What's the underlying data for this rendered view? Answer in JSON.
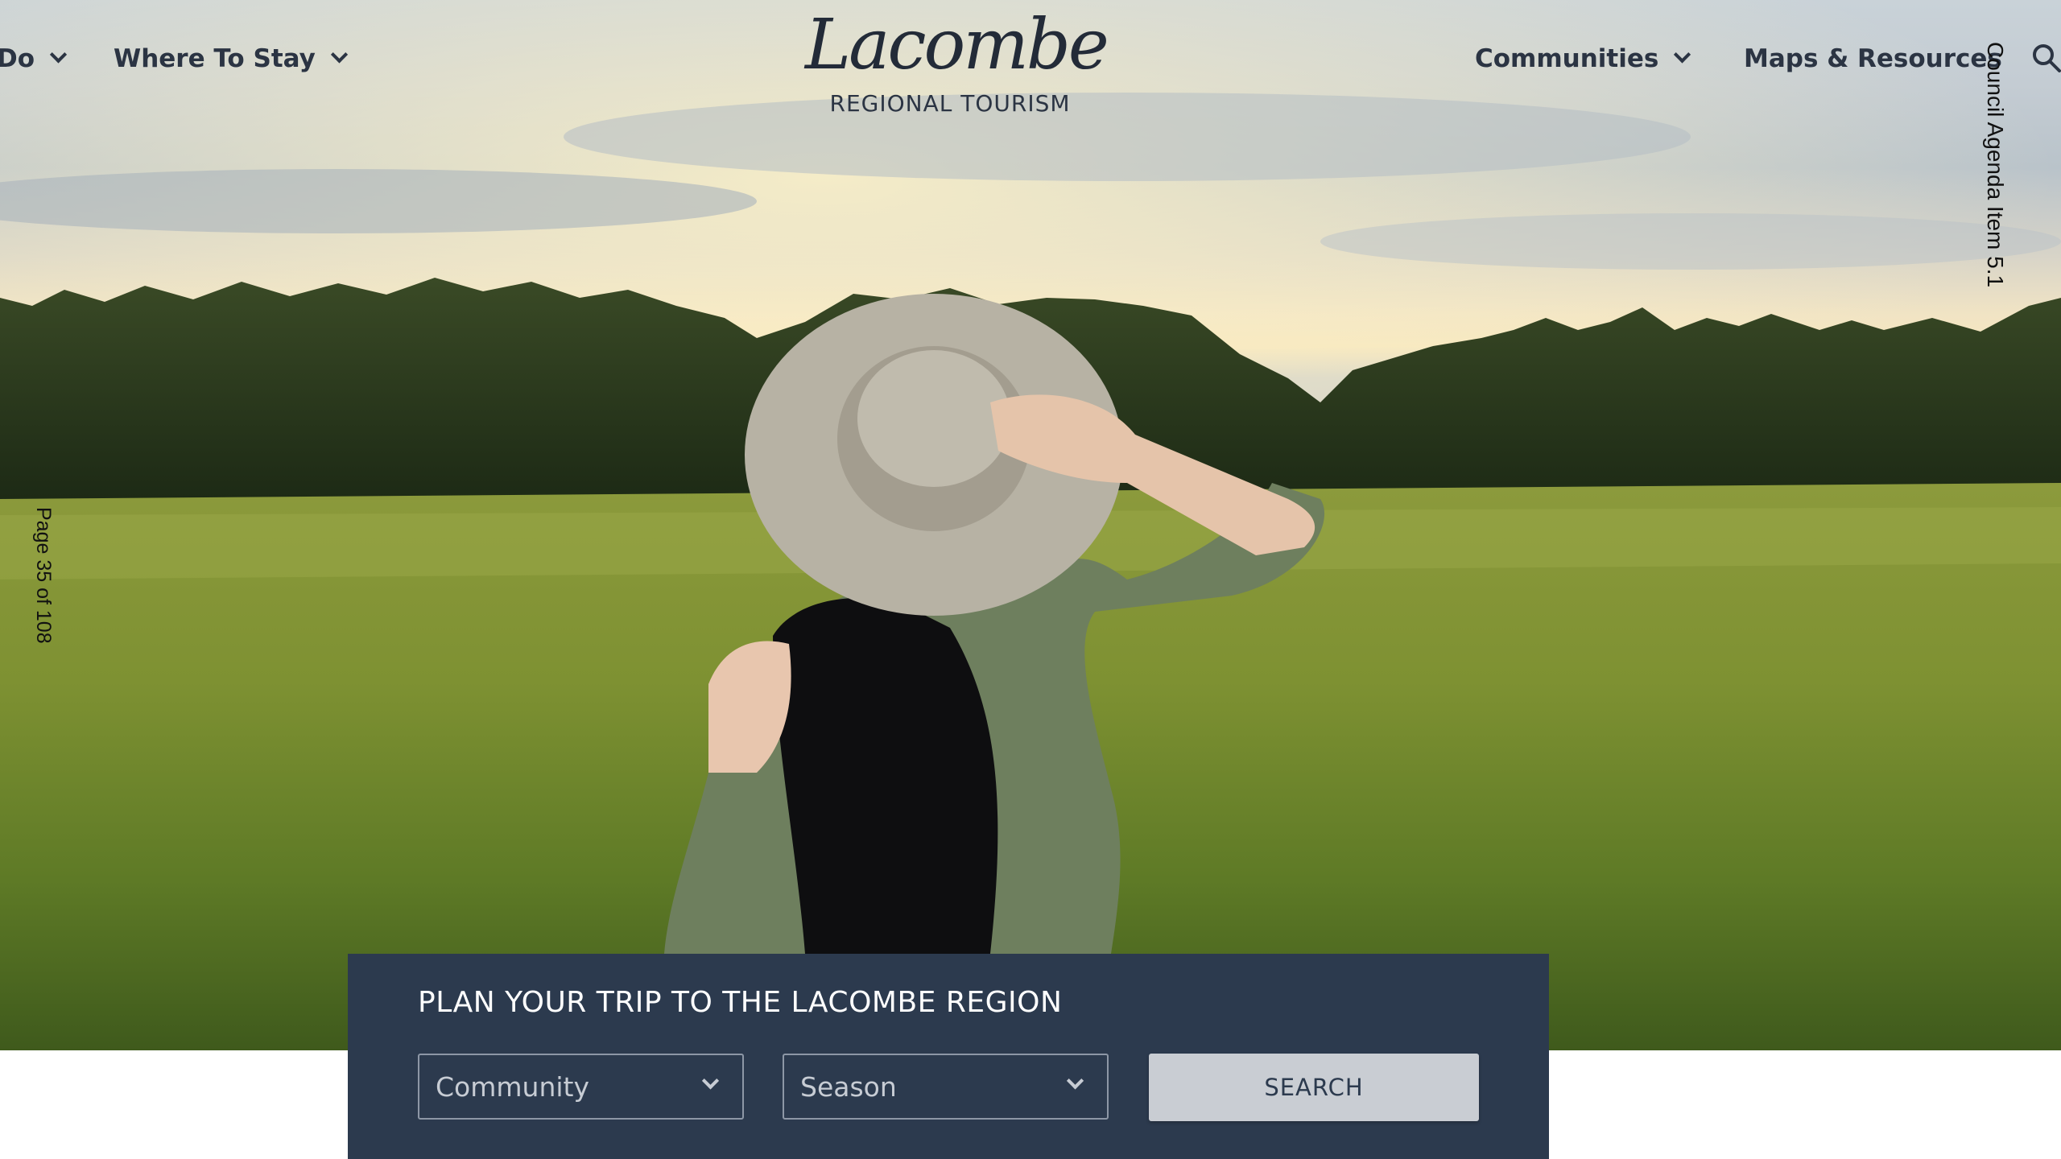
{
  "nav": {
    "left_items": [
      {
        "label": "Do",
        "has_dropdown": true
      },
      {
        "label": "Where To Stay",
        "has_dropdown": true
      }
    ],
    "right_items": [
      {
        "label": "Communities",
        "has_dropdown": true
      },
      {
        "label": "Maps & Resources",
        "has_dropdown": false
      }
    ],
    "search_icon": "search-icon"
  },
  "logo": {
    "script": "Lacombe",
    "subtitle": "REGIONAL TOURISM"
  },
  "side_notes": {
    "right": "Council Agenda Item 5.1",
    "left": "Page 35 of 108"
  },
  "planner": {
    "title": "PLAN YOUR TRIP TO THE LACOMBE REGION",
    "community_select": {
      "value": "Community"
    },
    "season_select": {
      "value": "Season"
    },
    "search_label": "SEARCH"
  },
  "colors": {
    "nav_text": "#2b3443",
    "panel_bg": "#2c3a4e",
    "button_bg": "#c9cdd3",
    "white": "#ffffff"
  }
}
